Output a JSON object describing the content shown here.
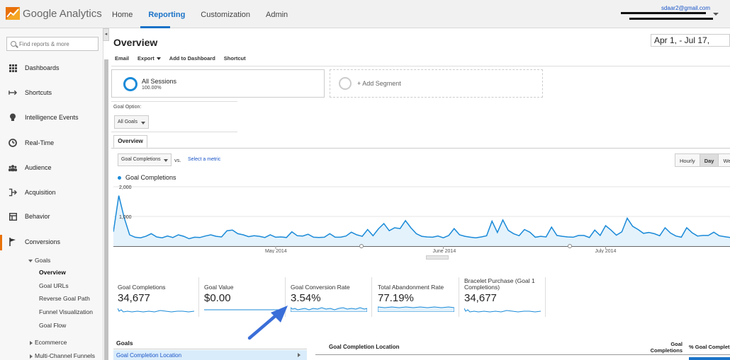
{
  "app": {
    "logo_text": "Google Analytics",
    "user_email": "sdaar2@gmail.com"
  },
  "nav": [
    "Home",
    "Reporting",
    "Customization",
    "Admin"
  ],
  "sidebar": {
    "search_placeholder": "Find reports & more",
    "items": [
      {
        "label": "Dashboards",
        "icon": "grid-icon"
      },
      {
        "label": "Shortcuts",
        "icon": "arrow-icon"
      },
      {
        "label": "Intelligence Events",
        "icon": "lightbulb-icon"
      },
      {
        "label": "Real-Time",
        "icon": "clock-icon"
      },
      {
        "label": "Audience",
        "icon": "people-icon"
      },
      {
        "label": "Acquisition",
        "icon": "acquisition-icon"
      },
      {
        "label": "Behavior",
        "icon": "behavior-icon"
      },
      {
        "label": "Conversions",
        "icon": "flag-icon"
      }
    ],
    "goals_label": "Goals",
    "goals_sub": [
      "Overview",
      "Goal URLs",
      "Reverse Goal Path",
      "Funnel Visualization",
      "Goal Flow"
    ],
    "ecommerce_label": "Ecommerce",
    "multichannel_label": "Multi-Channel Funnels"
  },
  "main": {
    "title": "Overview",
    "date_range": "Apr 1,       - Jul 17,",
    "toolbar": [
      "Email",
      "Export",
      "Add to Dashboard",
      "Shortcut"
    ],
    "segment": {
      "name": "All Sessions",
      "pct": "100.00%"
    },
    "add_segment": "+ Add Segment",
    "goal_option_label": "Goal Option:",
    "goal_option_value": "All Goals",
    "tab": "Overview",
    "metric_select": "Goal Completions",
    "vs": "vs.",
    "select_metric": "Select a metric",
    "granularity": [
      "Hourly",
      "Day",
      "Week"
    ],
    "granularity_active": "Day",
    "legend": "Goal Completions"
  },
  "chart_data": {
    "type": "area",
    "series": [
      {
        "name": "Goal Completions",
        "values": [
          480,
          1700,
          950,
          380,
          300,
          280,
          330,
          420,
          310,
          280,
          340,
          290,
          380,
          330,
          250,
          300,
          290,
          340,
          380,
          330,
          310,
          520,
          540,
          420,
          380,
          320,
          350,
          330,
          290,
          380,
          300,
          310,
          290,
          480,
          350,
          340,
          400,
          300,
          290,
          300,
          420,
          300,
          300,
          340,
          470,
          380,
          330,
          560,
          350,
          580,
          760,
          520,
          620,
          590,
          860,
          620,
          420,
          330,
          310,
          300,
          340,
          280,
          360,
          590,
          380,
          330,
          300,
          280,
          310,
          350,
          840,
          460,
          880,
          530,
          420,
          350,
          560,
          470,
          300,
          330,
          310,
          640,
          360,
          330,
          310,
          300,
          360,
          360,
          290,
          540,
          360,
          690,
          540,
          370,
          480,
          940,
          670,
          560,
          430,
          460,
          420,
          350,
          620,
          440,
          340,
          300,
          620,
          450,
          340,
          360,
          360,
          470,
          350,
          320,
          290
        ]
      }
    ],
    "x_ticks": [
      "May 2014",
      "June 2014",
      "July 2014"
    ],
    "y_ticks": [
      "2,000",
      "1,000"
    ],
    "ylim": [
      0,
      2000
    ]
  },
  "scorecards": [
    {
      "label": "Goal Completions",
      "value": "34,677"
    },
    {
      "label": "Goal Value",
      "value": "$0.00"
    },
    {
      "label": "Goal Conversion Rate",
      "value": "3.54%"
    },
    {
      "label": "Total Abandonment Rate",
      "value": "77.19%"
    },
    {
      "label": "Bracelet Purchase (Goal 1 Completions)",
      "value": "34,677"
    }
  ],
  "table": {
    "goals_header": "Goals",
    "goals_row": "Goal Completion Location",
    "col1": "Goal Completion Location",
    "col2": "Goal Completions",
    "col3": "% Goal Completions"
  },
  "colors": {
    "accent": "#1a8ad8",
    "active_nav": "#1a73c8",
    "logo_orange": "#e8710a"
  }
}
